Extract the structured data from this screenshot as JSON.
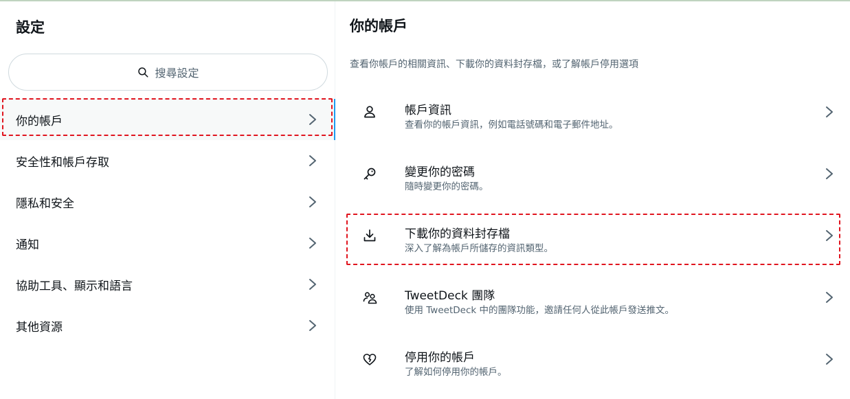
{
  "left": {
    "title": "設定",
    "search": {
      "icon": "search-icon",
      "placeholder": "搜尋設定"
    },
    "menu": [
      {
        "label": "你的帳戶",
        "active": true
      },
      {
        "label": "安全性和帳戶存取"
      },
      {
        "label": "隱私和安全"
      },
      {
        "label": "通知"
      },
      {
        "label": "協助工具、顯示和語言"
      },
      {
        "label": "其他資源"
      }
    ]
  },
  "right": {
    "title": "你的帳戶",
    "description": "查看你帳戶的相關資訊、下載你的資料封存檔，或了解帳戶停用選項",
    "options": [
      {
        "icon": "person-icon",
        "title": "帳戶資訊",
        "subtitle": "查看你的帳戶資訊，例如電話號碼和電子郵件地址。"
      },
      {
        "icon": "key-icon",
        "title": "變更你的密碼",
        "subtitle": "隨時變更你的密碼。"
      },
      {
        "icon": "download-icon",
        "title": "下載你的資料封存檔",
        "subtitle": "深入了解為帳戶所儲存的資訊類型。"
      },
      {
        "icon": "team-icon",
        "title": "TweetDeck 團隊",
        "subtitle": "使用 TweetDeck 中的團隊功能，邀請任何人從此帳戶發送推文。"
      },
      {
        "icon": "broken-heart-icon",
        "title": "停用你的帳戶",
        "subtitle": "了解如何停用你的帳戶。"
      }
    ]
  },
  "colors": {
    "accent": "#1d9bf0",
    "highlight_dash": "#e0141e",
    "secondary_text": "#536471"
  }
}
